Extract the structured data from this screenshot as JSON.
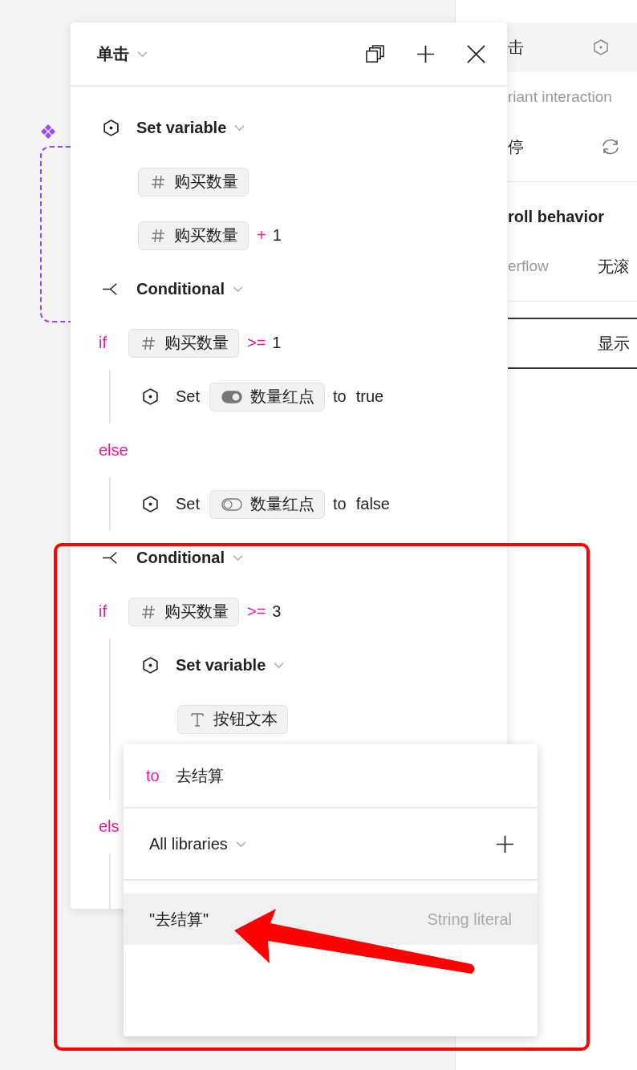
{
  "panel": {
    "trigger": "单击",
    "actions": [
      {
        "kind": "set_variable",
        "label": "Set variable",
        "target": {
          "kind": "number",
          "name": "购买数量"
        },
        "value": {
          "kind": "number",
          "name": "购买数量",
          "op": "+",
          "operand": "1"
        }
      },
      {
        "kind": "conditional",
        "label": "Conditional",
        "branches": [
          {
            "keyword": "if",
            "condition": {
              "kind": "number",
              "name": "购买数量",
              "op": ">=",
              "operand": "1"
            },
            "children": [
              {
                "kind": "set",
                "label": "Set",
                "target": {
                  "kind": "boolean",
                  "name": "数量红点",
                  "on": true
                },
                "to": "to",
                "value": "true"
              }
            ]
          },
          {
            "keyword": "else",
            "children": [
              {
                "kind": "set",
                "label": "Set",
                "target": {
                  "kind": "boolean",
                  "name": "数量红点",
                  "on": false
                },
                "to": "to",
                "value": "false"
              }
            ]
          }
        ]
      },
      {
        "kind": "conditional",
        "label": "Conditional",
        "branches": [
          {
            "keyword": "if",
            "condition": {
              "kind": "number",
              "name": "购买数量",
              "op": ">=",
              "operand": "3"
            },
            "children": [
              {
                "kind": "set_variable",
                "label": "Set variable",
                "target": {
                  "kind": "text",
                  "name": "按钮文本"
                }
              }
            ]
          },
          {
            "keyword": "els"
          }
        ]
      }
    ]
  },
  "popup": {
    "keyword": "to",
    "value": "去结算",
    "library": "All libraries",
    "options": [
      {
        "label": "\"去结算\"",
        "type": "String literal",
        "selected": true
      }
    ]
  },
  "sidebar": {
    "trigger": "击",
    "variant_note": "riant interaction",
    "hover_label": "停",
    "scroll_title": "roll behavior",
    "overflow_label": "erflow",
    "overflow_value": "无滚",
    "tab": "显示"
  }
}
